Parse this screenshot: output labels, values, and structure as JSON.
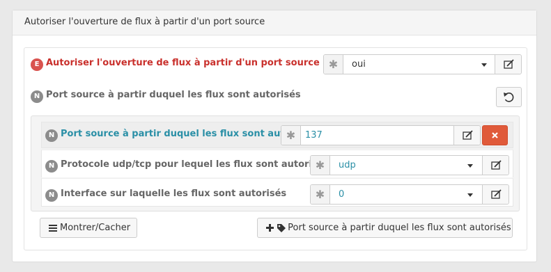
{
  "panel": {
    "title": "Autoriser l'ouverture de flux à partir d'un port source"
  },
  "main_field": {
    "badge": "E",
    "label": "Autoriser l'ouverture de flux à partir d'un port source",
    "value": "oui"
  },
  "port_group": {
    "badge": "N",
    "label": "Port source à partir duquel les flux sont autorisés"
  },
  "rows": {
    "port": {
      "badge": "N",
      "label": "Port source à partir duquel les flux sont autorisés",
      "value": "137"
    },
    "protocol": {
      "badge": "N",
      "label": "Protocole udp/tcp pour lequel les flux sont autorisés",
      "value": "udp"
    },
    "interface": {
      "badge": "N",
      "label": "Interface sur laquelle les flux sont autorisés",
      "value": "0"
    }
  },
  "buttons": {
    "toggle_label": "Montrer/Cacher",
    "add_label": "Port source à partir duquel les flux sont autorisés"
  },
  "icons": {
    "asterisk": "asterisk-icon",
    "edit": "edit-icon",
    "reset": "undo-icon",
    "remove": "close-icon",
    "menu": "bars-icon",
    "plus": "plus-icon",
    "tag": "tag-icon"
  },
  "colors": {
    "required_label": "#c9302c",
    "highlight_label": "#2a8fa6",
    "value_text": "#2a8fa6",
    "danger_button": "#e05a3a"
  }
}
